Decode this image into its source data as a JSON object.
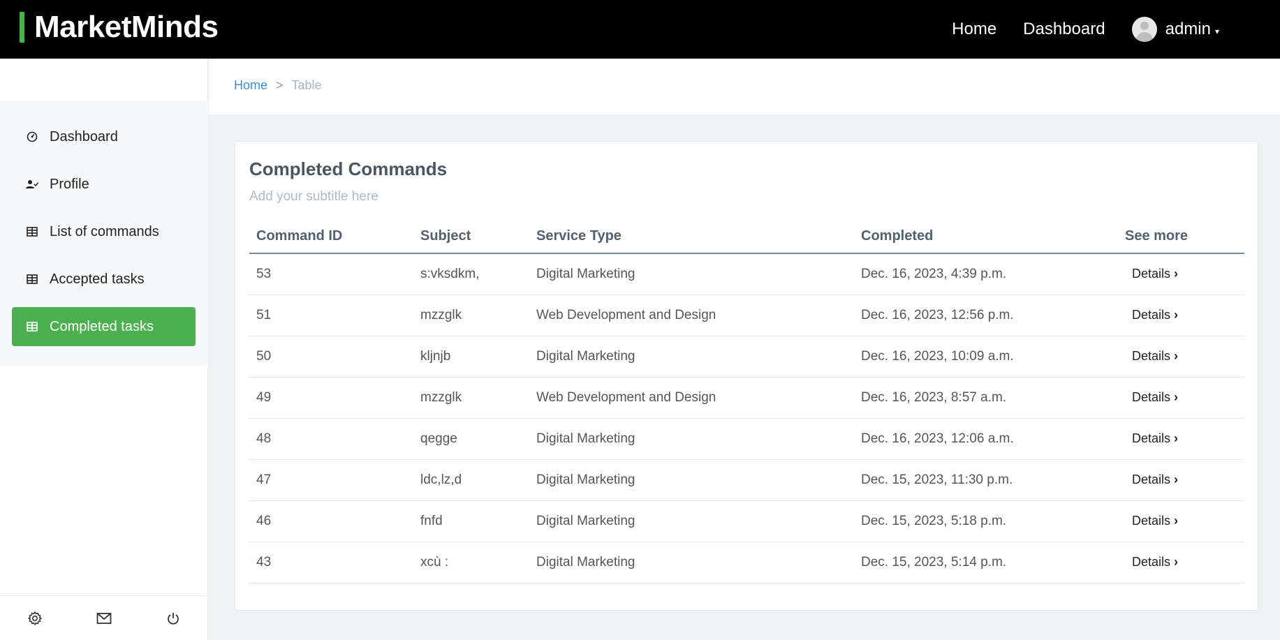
{
  "brand": {
    "name": "MarketMinds",
    "accent_color": "#4caf50"
  },
  "topnav": {
    "home": "Home",
    "dashboard": "Dashboard",
    "user": "admin",
    "caret": "▾"
  },
  "breadcrumb": {
    "home": "Home",
    "separator": ">",
    "current": "Table"
  },
  "sidebar": {
    "items": [
      {
        "label": "Dashboard",
        "icon": "dashboard-gauge-icon"
      },
      {
        "label": "Profile",
        "icon": "user-check-icon"
      },
      {
        "label": "List of commands",
        "icon": "table-icon"
      },
      {
        "label": "Accepted tasks",
        "icon": "table-icon"
      },
      {
        "label": "Completed tasks",
        "icon": "table-icon",
        "active": true
      }
    ],
    "footer_icons": [
      "settings-gear-icon",
      "mail-icon",
      "power-icon"
    ]
  },
  "card": {
    "title": "Completed Commands",
    "subtitle": "Add your subtitle here",
    "columns": [
      "Command ID",
      "Subject",
      "Service Type",
      "Completed",
      "See more"
    ],
    "details_label": "Details",
    "details_chevron": "›",
    "rows": [
      {
        "id": "53",
        "subject": "s:vksdkm,",
        "service": "Digital Marketing",
        "completed": "Dec. 16, 2023, 4:39 p.m."
      },
      {
        "id": "51",
        "subject": "mzzglk",
        "service": "Web Development and Design",
        "completed": "Dec. 16, 2023, 12:56 p.m."
      },
      {
        "id": "50",
        "subject": "kljnjb",
        "service": "Digital Marketing",
        "completed": "Dec. 16, 2023, 10:09 a.m."
      },
      {
        "id": "49",
        "subject": "mzzglk",
        "service": "Web Development and Design",
        "completed": "Dec. 16, 2023, 8:57 a.m."
      },
      {
        "id": "48",
        "subject": "qegge",
        "service": "Digital Marketing",
        "completed": "Dec. 16, 2023, 12:06 a.m."
      },
      {
        "id": "47",
        "subject": "ldc,lz,d",
        "service": "Digital Marketing",
        "completed": "Dec. 15, 2023, 11:30 p.m."
      },
      {
        "id": "46",
        "subject": "fnfd",
        "service": "Digital Marketing",
        "completed": "Dec. 15, 2023, 5:18 p.m."
      },
      {
        "id": "43",
        "subject": "xcù :",
        "service": "Digital Marketing",
        "completed": "Dec. 15, 2023, 5:14 p.m."
      }
    ]
  }
}
